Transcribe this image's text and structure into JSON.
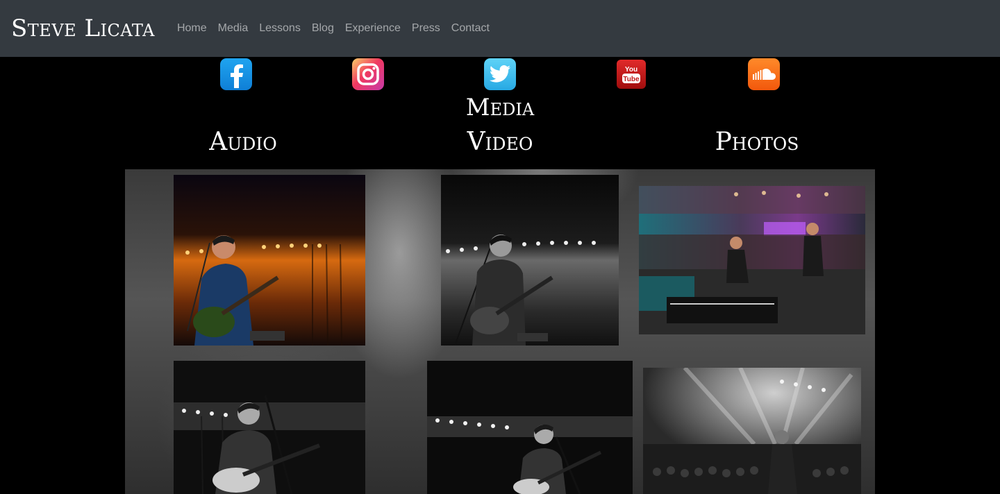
{
  "navbar": {
    "brand": "Steve Licata",
    "links": [
      "Home",
      "Media",
      "Lessons",
      "Blog",
      "Experience",
      "Press",
      "Contact"
    ]
  },
  "social": [
    {
      "name": "facebook-icon"
    },
    {
      "name": "instagram-icon"
    },
    {
      "name": "twitter-icon"
    },
    {
      "name": "youtube-icon",
      "label": "You Tube"
    },
    {
      "name": "soundcloud-icon"
    }
  ],
  "page": {
    "title": "Media",
    "sections": [
      "Audio",
      "Video",
      "Photos"
    ]
  },
  "colors": {
    "navbar_bg": "#343a40",
    "page_bg": "#000000",
    "nav_link": "rgba(255,255,255,0.55)"
  }
}
